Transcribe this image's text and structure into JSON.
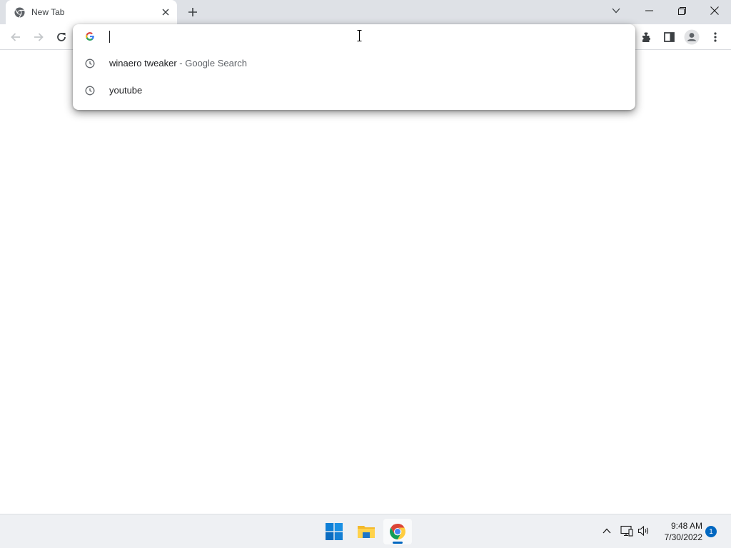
{
  "tab": {
    "title": "New Tab",
    "favicon": "chrome-icon"
  },
  "window_controls": [
    "tab-search-icon",
    "minimize-icon",
    "restore-icon",
    "close-icon"
  ],
  "toolbar": {
    "nav_icons": [
      "back-arrow-icon",
      "forward-arrow-icon",
      "reload-icon"
    ],
    "right_icons": [
      "extensions-icon",
      "side-panel-icon",
      "profile-icon",
      "menu-icon"
    ]
  },
  "omnibox": {
    "value": "",
    "provider_icon": "google-g-icon",
    "suggestions": [
      {
        "text": "winaero tweaker",
        "desc": "- Google Search",
        "icon": "history-clock-icon"
      },
      {
        "text": "youtube",
        "desc": "",
        "icon": "history-clock-icon"
      }
    ]
  },
  "taskbar": {
    "apps": [
      "windows-start-icon",
      "file-explorer-icon",
      "chrome-icon"
    ],
    "tray_icons": [
      "chevron-up-icon",
      "network-icon",
      "volume-icon"
    ],
    "time": "9:48 AM",
    "date": "7/30/2022",
    "notification_count": "1"
  },
  "colors": {
    "tabstrip_bg": "#dee1e6",
    "taskbar_bg": "#eef0f3",
    "accent_blue": "#0067c0",
    "text_secondary": "#5f6368"
  }
}
